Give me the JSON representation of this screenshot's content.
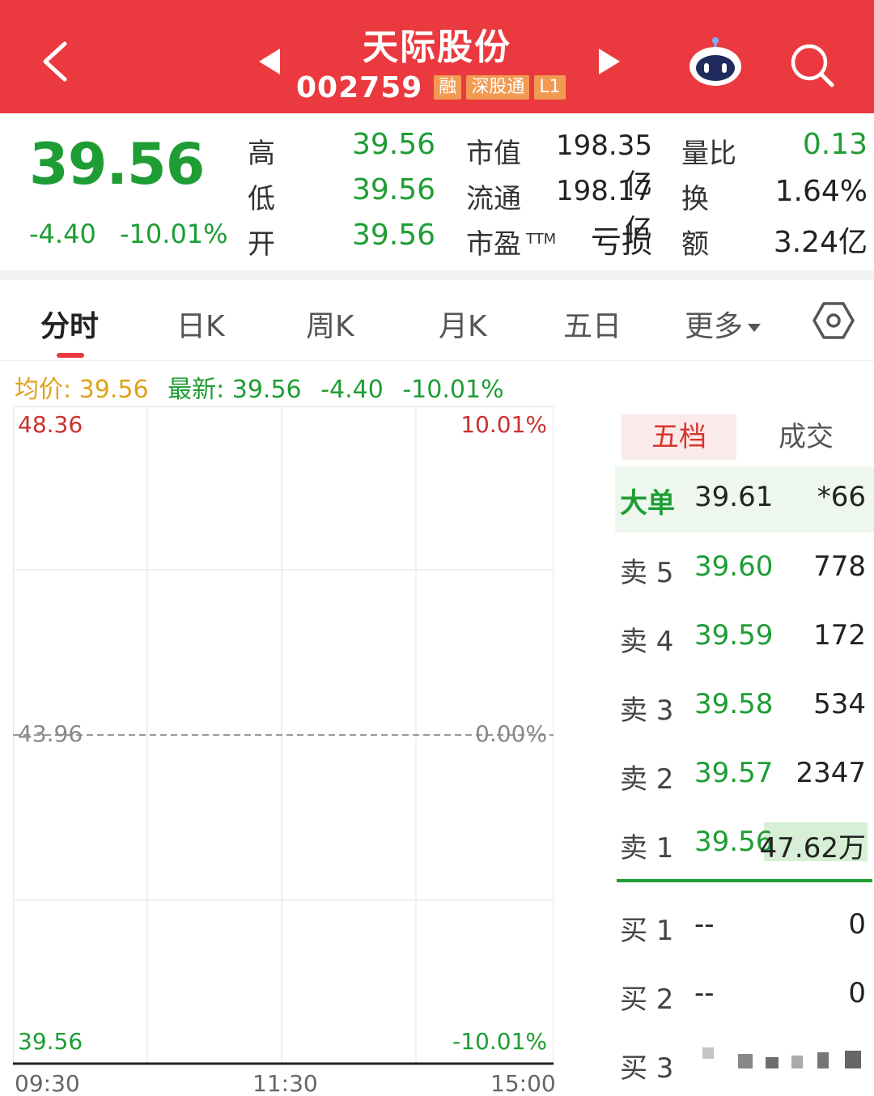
{
  "header": {
    "title": "天际股份",
    "code": "002759",
    "badges": [
      "融",
      "深股通",
      "L1"
    ]
  },
  "quote": {
    "price": "39.56",
    "change": "-4.40",
    "change_pct": "-10.01%",
    "high_label": "高",
    "high": "39.56",
    "low_label": "低",
    "low": "39.56",
    "open_label": "开",
    "open": "39.56",
    "mcap_label": "市值",
    "mcap": "198.35亿",
    "float_label": "流通",
    "float_cap": "198.17亿",
    "pe_label": "市盈",
    "pe_sup": "TTM",
    "pe": "亏损",
    "vr_label": "量比",
    "vr": "0.13",
    "turnover_label": "换",
    "turnover": "1.64%",
    "amount_label": "额",
    "amount": "3.24亿"
  },
  "tabs": {
    "items": [
      "分时",
      "日K",
      "周K",
      "月K",
      "五日",
      "更多"
    ]
  },
  "info": {
    "avg_label": "均价:",
    "avg": "39.56",
    "latest_label": "最新:",
    "latest": "39.56",
    "change": "-4.40",
    "change_pct": "-10.01%"
  },
  "chart_data": {
    "type": "line",
    "y_left_ticks": [
      "48.36",
      "43.96",
      "39.56"
    ],
    "y_right_ticks": [
      "10.01%",
      "0.00%",
      "-10.01%"
    ],
    "x_ticks": [
      "09:30",
      "11:30",
      "15:00"
    ],
    "ylim": [
      39.56,
      48.36
    ],
    "prev_close": 43.96,
    "series": [
      {
        "values": [
          39.56
        ]
      }
    ],
    "grid": true
  },
  "orderbook": {
    "tabs": [
      "五档",
      "成交"
    ],
    "big_order": {
      "label": "大单",
      "price": "39.61",
      "vol": "*66"
    },
    "asks": [
      {
        "label": "卖 5",
        "price": "39.60",
        "vol": "778"
      },
      {
        "label": "卖 4",
        "price": "39.59",
        "vol": "172"
      },
      {
        "label": "卖 3",
        "price": "39.58",
        "vol": "534"
      },
      {
        "label": "卖 2",
        "price": "39.57",
        "vol": "2347"
      },
      {
        "label": "卖 1",
        "price": "39.56",
        "vol": "47.62万"
      }
    ],
    "bids": [
      {
        "label": "买 1",
        "price": "--",
        "vol": "0"
      },
      {
        "label": "买 2",
        "price": "--",
        "vol": "0"
      },
      {
        "label": "买 3",
        "price": "",
        "vol": ""
      }
    ]
  },
  "colors": {
    "header_red": "#ea3a3f",
    "down_green": "#1e9d34",
    "up_red": "#c9322f",
    "avg_yellow": "#e0a21c"
  }
}
